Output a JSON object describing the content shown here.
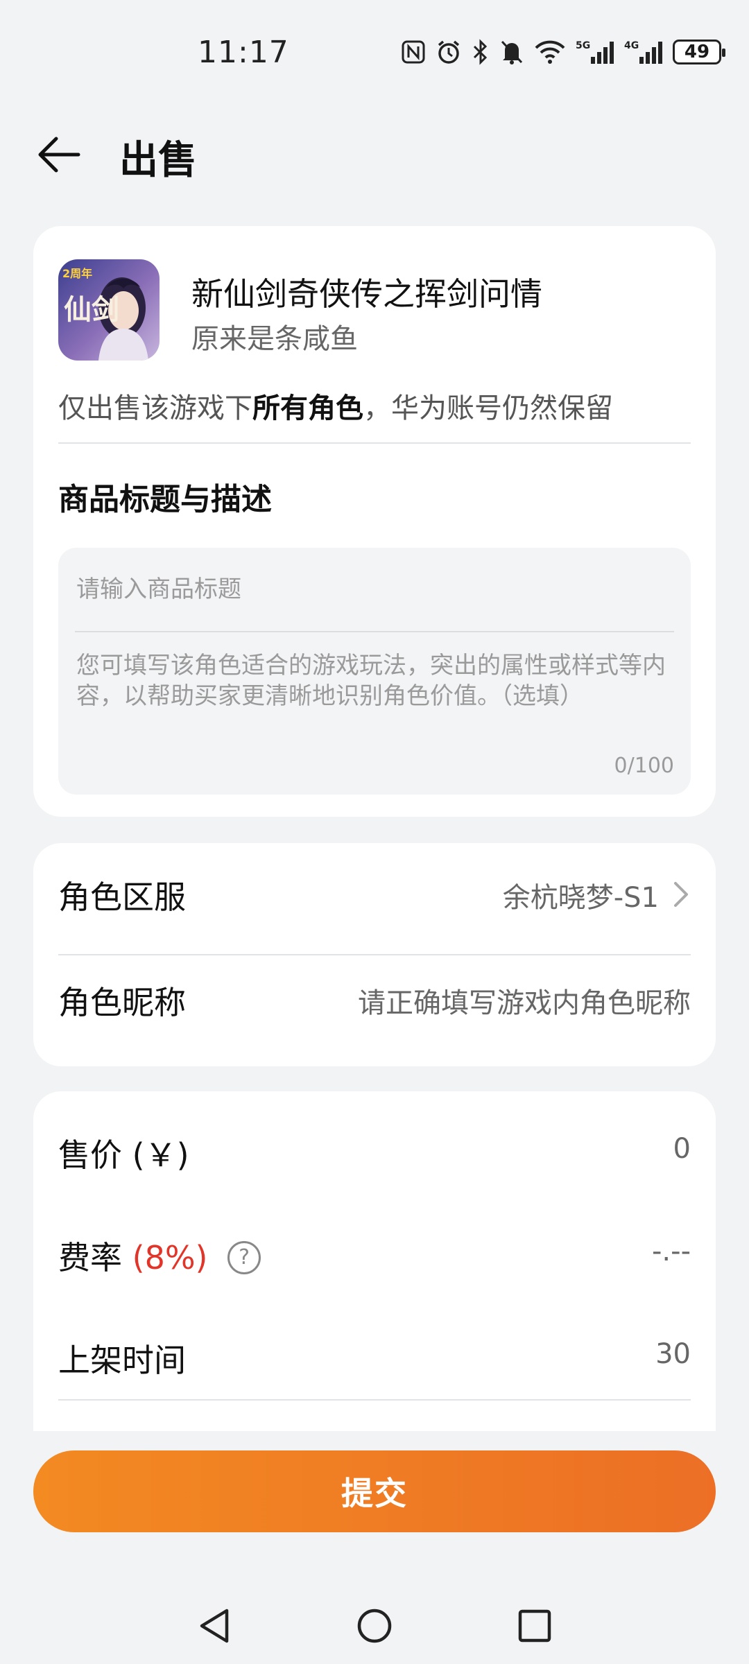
{
  "status_bar": {
    "time": "11:17",
    "battery": "49",
    "icons": [
      "nfc-icon",
      "alarm-icon",
      "bluetooth-icon",
      "mute-icon",
      "wifi-icon",
      "signal-5g-icon",
      "signal-4g-icon",
      "battery-icon"
    ],
    "network_labels": [
      "5G",
      "4G"
    ]
  },
  "header": {
    "title": "出售",
    "back_icon": "back-arrow-icon"
  },
  "game": {
    "name": "新仙剑奇侠传之挥剑问情",
    "seller": "原来是条咸鱼",
    "notice_prefix": "仅出售该游戏下",
    "notice_bold": "所有角色",
    "notice_suffix": "，华为账号仍然保留",
    "icon_name": "game-logo-icon",
    "icon_text": "仙剑",
    "icon_badge": "2周年"
  },
  "description_section": {
    "title": "商品标题与描述",
    "title_placeholder": "请输入商品标题",
    "desc_placeholder": "您可填写该角色适合的游戏玩法，突出的属性或样式等内容，以帮助买家更清晰地识别角色价值。（选填）",
    "counter": "0/100"
  },
  "role": {
    "server_label": "角色区服",
    "server_value": "余杭晓梦-S1",
    "nickname_label": "角色昵称",
    "nickname_placeholder": "请正确填写游戏内角色昵称"
  },
  "pricing": {
    "price_label": "售价 (￥)",
    "price_value": "0",
    "fee_label": "费率",
    "fee_rate": "(8%)",
    "fee_value": "-.--",
    "listing_label": "上架时间",
    "listing_value": "30"
  },
  "submit_label": "提交",
  "colors": {
    "accent": "#ef7a24",
    "fee_red": "#e2352a",
    "background": "#f1f3f5"
  }
}
